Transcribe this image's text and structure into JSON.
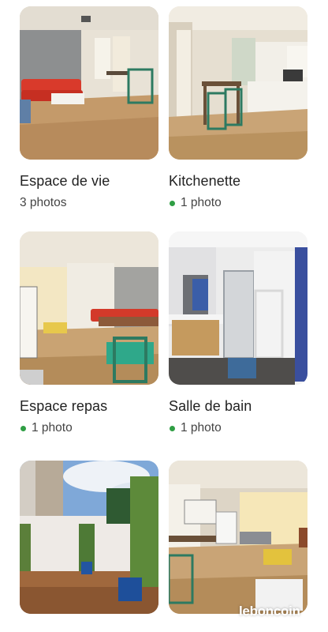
{
  "albums": [
    {
      "title": "Espace de vie",
      "count": "3 photos",
      "new": false
    },
    {
      "title": "Kitchenette",
      "count": "1 photo",
      "new": true
    },
    {
      "title": "Espace repas",
      "count": "1 photo",
      "new": true
    },
    {
      "title": "Salle de bain",
      "count": "1 photo",
      "new": true
    },
    {
      "title": "",
      "count": "",
      "new": false
    },
    {
      "title": "",
      "count": "",
      "new": false
    }
  ],
  "watermark": "leboncoin",
  "colors": {
    "new_dot": "#2f9e44",
    "text": "#222222",
    "subtext": "#444444"
  }
}
